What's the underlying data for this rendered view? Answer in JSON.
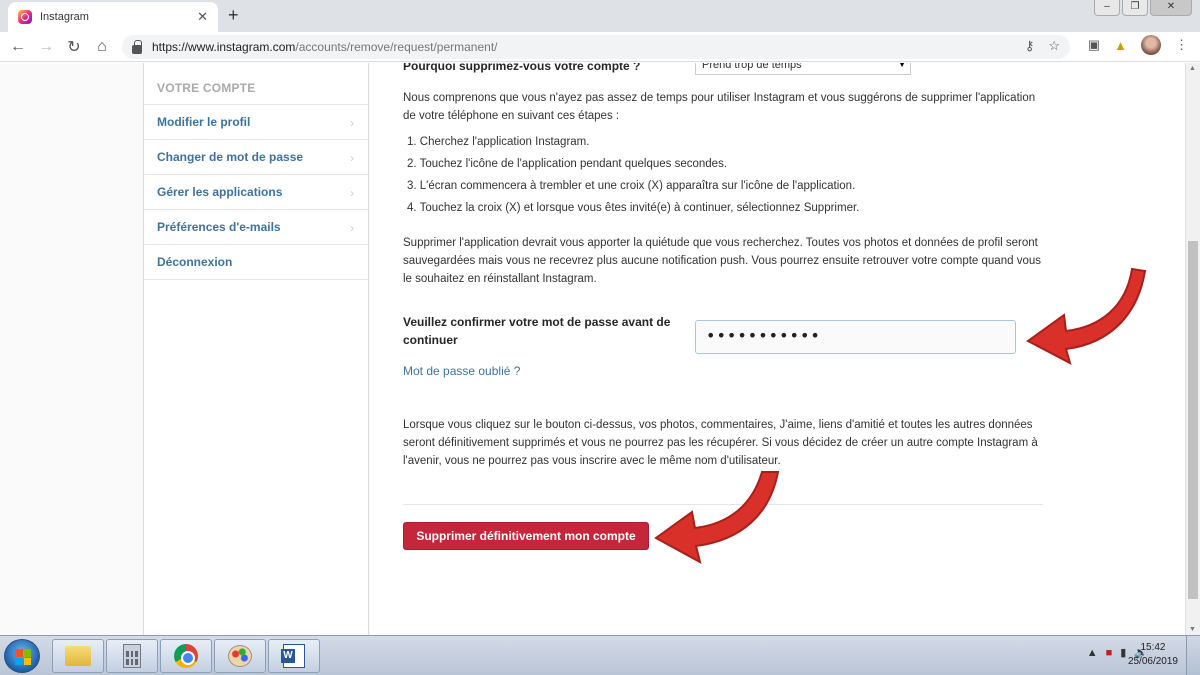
{
  "browser": {
    "tab_title": "Instagram",
    "tab_close": "✕",
    "new_tab": "+",
    "url_domain": "https://www.instagram.com",
    "url_path": "/accounts/remove/request/permanent/",
    "window_controls": [
      "‒",
      "❐",
      "✕"
    ]
  },
  "sidebar": {
    "header": "VOTRE COMPTE",
    "items": [
      {
        "label": "Modifier le profil"
      },
      {
        "label": "Changer de mot de passe"
      },
      {
        "label": "Gérer les applications"
      },
      {
        "label": "Préférences d'e-mails"
      },
      {
        "label": "Déconnexion"
      }
    ]
  },
  "content": {
    "reason_label": "Pourquoi supprimez-vous votre compte ?",
    "reason_selected": "Prend trop de temps",
    "intro": "Nous comprenons que vous n'ayez pas assez de temps pour utiliser Instagram et vous suggérons de supprimer l'application de votre téléphone en suivant ces étapes :",
    "steps": [
      "1. Cherchez l'application Instagram.",
      "2. Touchez l'icône de l'application pendant quelques secondes.",
      "3. L'écran commencera à trembler et une croix (X) apparaîtra sur l'icône de l'application.",
      "4. Touchez la croix (X) et lorsque vous êtes invité(e) à continuer, sélectionnez Supprimer."
    ],
    "reassurance": "Supprimer l'application devrait vous apporter la quiétude que vous recherchez. Toutes vos photos et données de profil seront sauvegardées mais vous ne recevrez plus aucune notification push. Vous pourrez ensuite retrouver votre compte quand vous le souhaitez en réinstallant Instagram.",
    "password_label": "Veuillez confirmer votre mot de passe avant de continuer",
    "password_value": "•••••••••••",
    "forgot_link": "Mot de passe oublié ?",
    "warning": "Lorsque vous cliquez sur le bouton ci-dessus, vos photos, commentaires, J'aime, liens d'amitié et toutes les autres données seront définitivement supprimés et vous ne pourrez pas les récupérer. Si vous décidez de créer un autre compte Instagram à l'avenir, vous ne pourrez pas vous inscrire avec le même nom d'utilisateur.",
    "delete_button": "Supprimer définitivement mon compte"
  },
  "taskbar": {
    "time": "15:42",
    "date": "25/06/2019"
  },
  "colors": {
    "link": "#3f729b",
    "delete_button": "#c6263c",
    "annotation_arrow": "#d9302a"
  }
}
